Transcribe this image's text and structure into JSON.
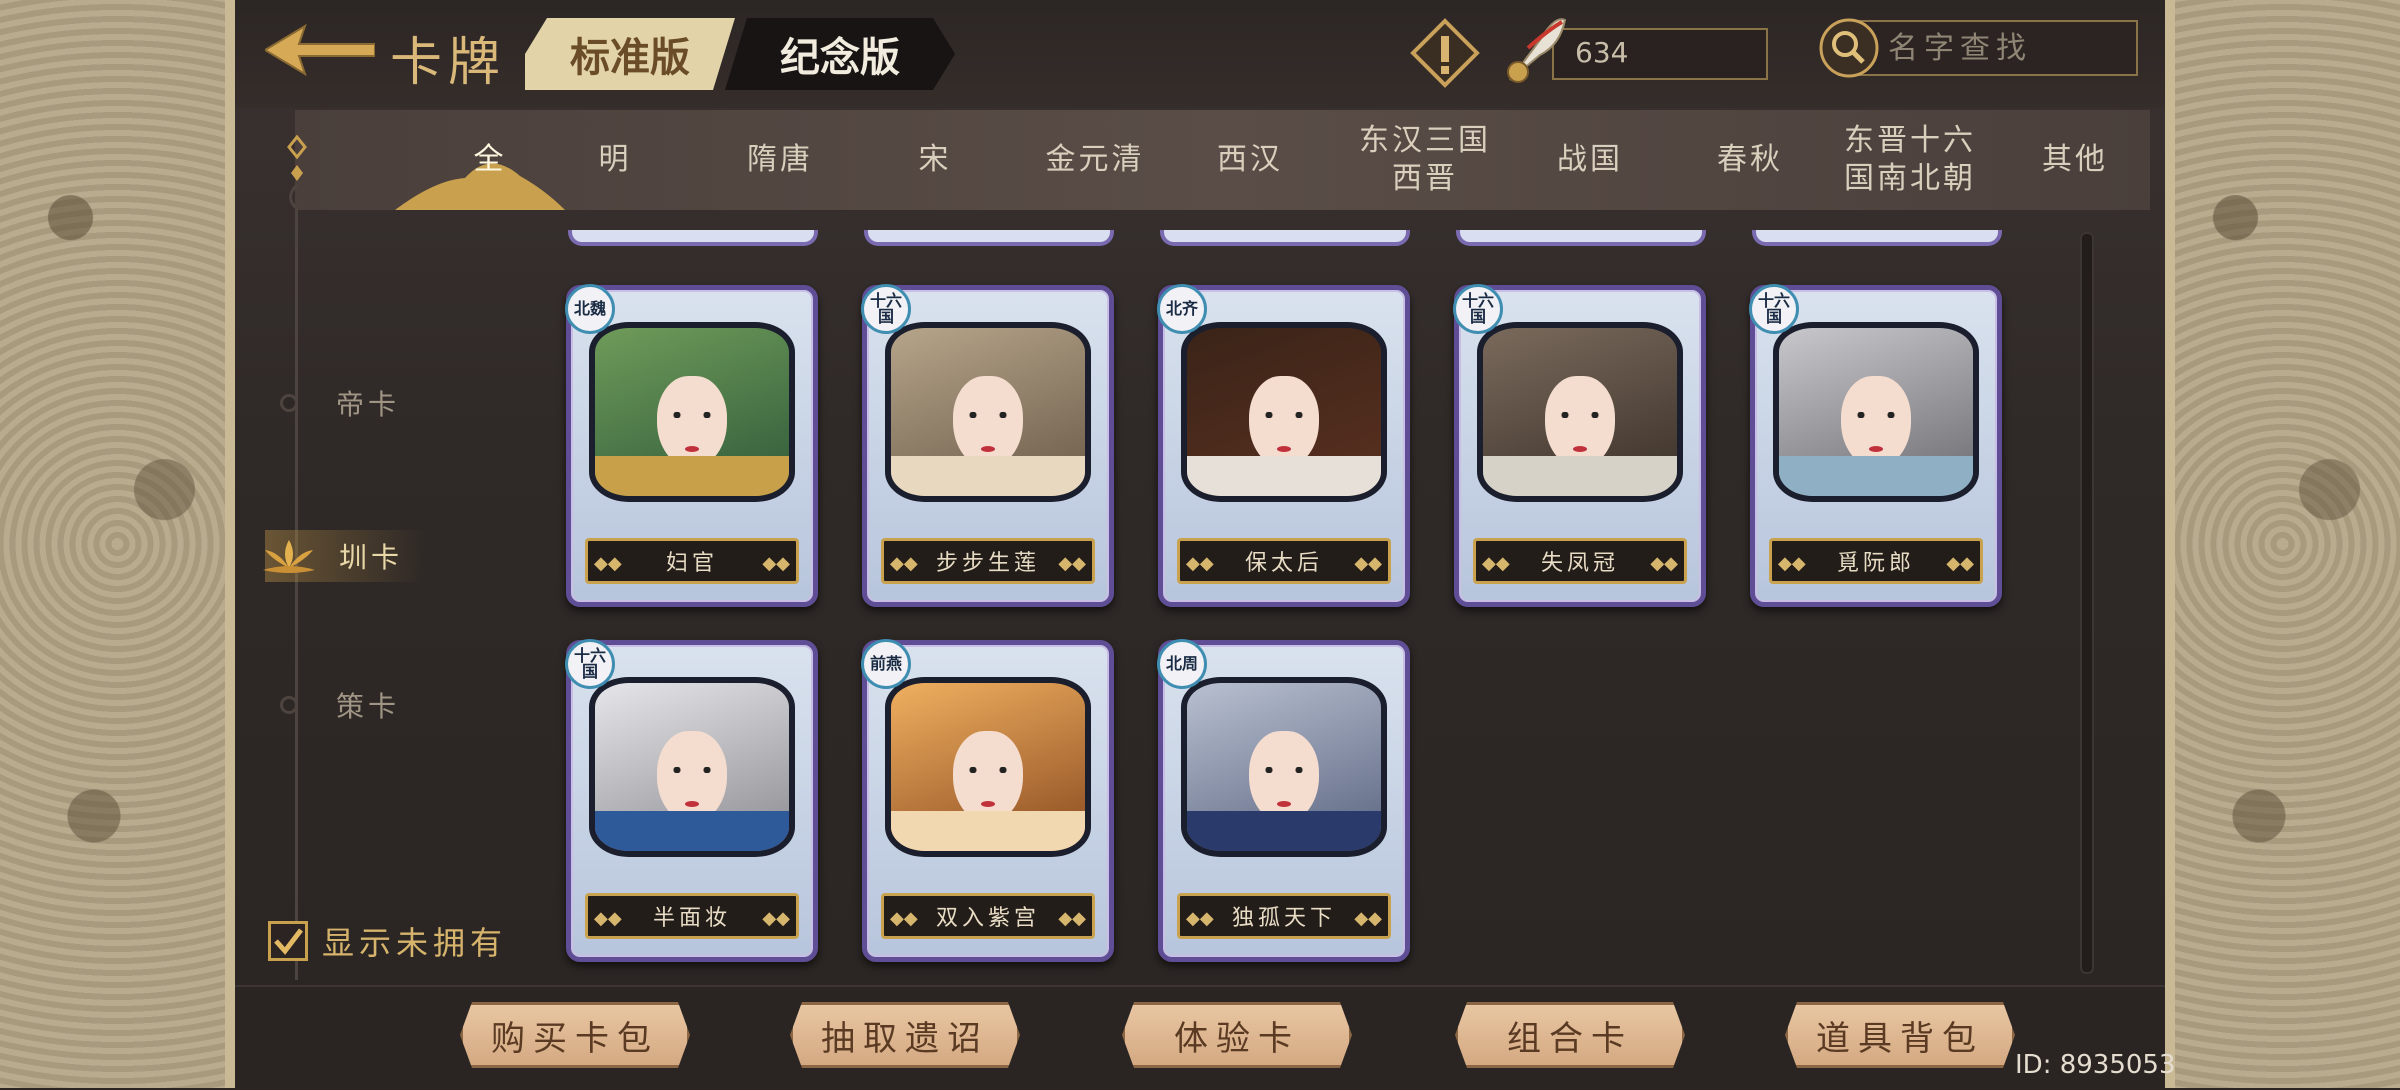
{
  "header": {
    "title": "卡牌",
    "version_tabs": [
      {
        "label": "标准版",
        "active": true
      },
      {
        "label": "纪念版",
        "active": false
      }
    ],
    "currency_value": "634",
    "search_placeholder": "名字查找"
  },
  "categories": [
    {
      "label": "全",
      "active": true
    },
    {
      "label": "明"
    },
    {
      "label": "隋唐"
    },
    {
      "label": "宋"
    },
    {
      "label": "金元清"
    },
    {
      "label": "西汉"
    },
    {
      "label": "东汉三国\n西晋"
    },
    {
      "label": "战国"
    },
    {
      "label": "春秋"
    },
    {
      "label": "东晋十六\n国南北朝"
    },
    {
      "label": "其他"
    }
  ],
  "rarity_nav": [
    {
      "label": "帝卡",
      "active": false
    },
    {
      "label": "圳卡",
      "active": true
    },
    {
      "label": "策卡",
      "active": false
    }
  ],
  "show_unowned": {
    "label": "显示未拥有",
    "checked": true
  },
  "cards": [
    {
      "name": "妇官",
      "badge": "北魏"
    },
    {
      "name": "步步生莲",
      "badge": "十六国"
    },
    {
      "name": "保太后",
      "badge": "北齐"
    },
    {
      "name": "失凤冠",
      "badge": "十六国"
    },
    {
      "name": "覓阮郎",
      "badge": "十六国"
    },
    {
      "name": "半面妆",
      "badge": "十六国"
    },
    {
      "name": "双入紫宫",
      "badge": "前燕"
    },
    {
      "name": "独孤天下",
      "badge": "北周"
    }
  ],
  "bottom_buttons": [
    "购买卡包",
    "抽取遗诏",
    "体验卡",
    "组合卡",
    "道具背包"
  ],
  "uid": "ID: 8935053",
  "colors": {
    "gold": "#d9b879",
    "card_border": "#5f4e95",
    "button": "#e0b993"
  }
}
